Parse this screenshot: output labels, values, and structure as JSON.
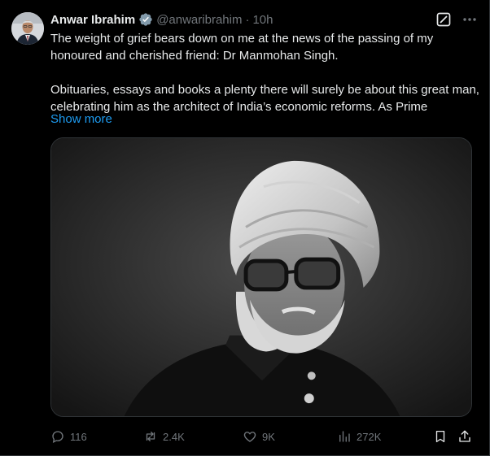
{
  "tweet": {
    "author_name": "Anwar Ibrahim",
    "handle": "@anwaribrahim",
    "separator": "·",
    "time": "10h",
    "paragraph_1": "The weight of grief bears down on me at the news of the passing of my honoured and cherished friend: Dr Manmohan Singh.",
    "paragraph_2": "Obituaries, essays and books a plenty there will surely be about this great man, celebrating him as the architect of India’s economic reforms. As Prime",
    "show_more": "Show more"
  },
  "stats": {
    "replies": "116",
    "reposts": "2.4K",
    "likes": "9K",
    "views": "272K"
  },
  "colors": {
    "background": "#000000",
    "text": "#e7e9ea",
    "muted": "#71767b",
    "link": "#1d9bf0",
    "border": "#2f3336",
    "verified_badge": "#829aab"
  },
  "icons": {
    "verified": "verified-badge-icon",
    "grok": "grok-icon",
    "more": "more-icon",
    "reply": "reply-icon",
    "repost": "repost-icon",
    "like": "heart-icon",
    "views": "views-icon",
    "bookmark": "bookmark-icon",
    "share": "share-icon"
  }
}
